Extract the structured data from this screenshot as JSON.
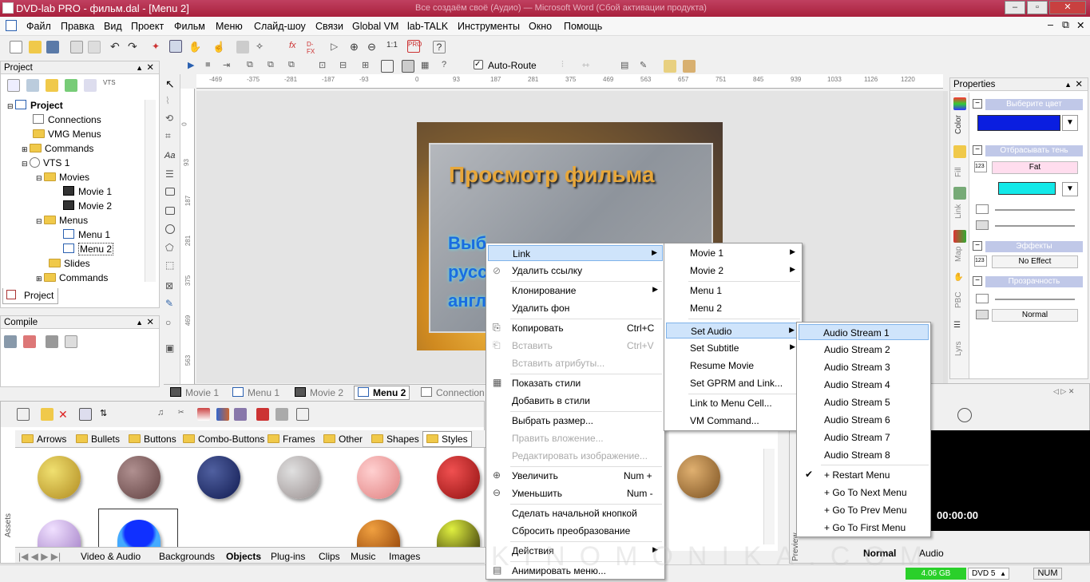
{
  "window": {
    "title": "DVD-lab PRO - фильм.dal - [Menu 2]",
    "center_title": "Все создаём своё (Аудио) — Microsoft Word (Сбой активации продукта)"
  },
  "menubar": [
    "Файл",
    "Правка",
    "Вид",
    "Проект",
    "Фильм",
    "Меню",
    "Слайд-шоу",
    "Связи",
    "Global VM",
    "lab-TALK",
    "Инструменты",
    "Окно",
    "Помощь"
  ],
  "toolbar2": {
    "autoroute": "Auto-Route"
  },
  "project_panel": {
    "title": "Project",
    "tab": "Project",
    "tree": [
      {
        "label": "Project",
        "bold": true
      },
      {
        "label": "Connections"
      },
      {
        "label": "VMG Menus"
      },
      {
        "label": "Commands"
      },
      {
        "label": "VTS 1"
      },
      {
        "label": "Movies"
      },
      {
        "label": "Movie 1"
      },
      {
        "label": "Movie 2"
      },
      {
        "label": "Menus"
      },
      {
        "label": "Menu 1"
      },
      {
        "label": "Menu 2"
      },
      {
        "label": "Slides"
      },
      {
        "label": "Commands"
      }
    ]
  },
  "compile_panel": {
    "title": "Compile"
  },
  "ruler": {
    "h": [
      "-469",
      "-375",
      "-281",
      "-187",
      "-93",
      "0",
      "93",
      "187",
      "281",
      "375",
      "469",
      "563",
      "657",
      "751",
      "845",
      "939",
      "1033",
      "1126",
      "1220"
    ],
    "v": [
      "0",
      "93",
      "187",
      "281",
      "375",
      "469",
      "563"
    ]
  },
  "menu_canvas": {
    "title": "Просмотр фильма",
    "line1": "Выбор звуковой дорожки",
    "line2": "русс",
    "line3": "англ"
  },
  "doc_tabs": [
    "Movie 1",
    "Menu 1",
    "Movie 2",
    "Menu 2",
    "Connection"
  ],
  "properties": {
    "title": "Properties",
    "sections": [
      "Выберите цвет",
      "Отбрасывать тень",
      "Эффекты",
      "Прозрачность"
    ],
    "shadow_value": "Fat",
    "effect_value": "No Effect",
    "blend_value": "Normal",
    "side_tabs": [
      "Color",
      "Fill",
      "Link",
      "Map",
      "PBC",
      "Lyrs"
    ],
    "num_label": "123"
  },
  "context_menu": {
    "items": [
      {
        "label": "Link",
        "shortcut": "",
        "arrow": true,
        "highlight": true
      },
      {
        "label": "Удалить ссылку"
      },
      {
        "label": "Клонирование",
        "arrow": true
      },
      {
        "label": "Удалить фон"
      },
      {
        "label": "Копировать",
        "shortcut": "Ctrl+C"
      },
      {
        "label": "Вставить",
        "shortcut": "Ctrl+V",
        "disabled": true
      },
      {
        "label": "Вставить атрибуты...",
        "disabled": true
      },
      {
        "label": "Показать стили"
      },
      {
        "label": "Добавить в стили"
      },
      {
        "label": "Выбрать размер..."
      },
      {
        "label": "Править вложение...",
        "disabled": true
      },
      {
        "label": "Редактировать изображение...",
        "disabled": true
      },
      {
        "label": "Увеличить",
        "shortcut": "Num +"
      },
      {
        "label": "Уменьшить",
        "shortcut": "Num -"
      },
      {
        "label": "Сделать начальной кнопкой"
      },
      {
        "label": "Сбросить преобразование"
      },
      {
        "label": "Действия",
        "arrow": true
      },
      {
        "label": "Анимировать меню..."
      }
    ]
  },
  "link_menu": {
    "items": [
      {
        "label": "Movie 1",
        "arrow": true
      },
      {
        "label": "Movie 2",
        "arrow": true
      },
      {
        "label": "Menu 1"
      },
      {
        "label": "Menu 2"
      },
      {
        "label": "Set Audio",
        "arrow": true,
        "highlight": true
      },
      {
        "label": "Set Subtitle",
        "arrow": true
      },
      {
        "label": "Resume Movie"
      },
      {
        "label": "Set GPRM and Link..."
      },
      {
        "label": "Link to Menu Cell..."
      },
      {
        "label": "VM Command..."
      }
    ]
  },
  "audio_menu": {
    "items": [
      "Audio Stream 1",
      "Audio Stream 2",
      "Audio Stream 3",
      "Audio Stream 4",
      "Audio Stream 5",
      "Audio Stream 6",
      "Audio Stream 7",
      "Audio Stream 8"
    ],
    "actions": [
      "+ Restart Menu",
      "+ Go To Next Menu",
      "+ Go To Prev Menu",
      "+ Go To First Menu"
    ]
  },
  "assets": {
    "folder_tabs": [
      "Arrows",
      "Bullets",
      "Buttons",
      "Combo-Buttons",
      "Frames",
      "Other",
      "Shapes",
      "Styles"
    ],
    "bottom_tabs": [
      "Video & Audio",
      "Backgrounds",
      "Objects",
      "Plug-ins",
      "Clips",
      "Music",
      "Images"
    ],
    "side_label": "Assets"
  },
  "preview": {
    "time": "00:00:00",
    "tabs": [
      "Normal",
      "Audio"
    ],
    "side_label": "Preview"
  },
  "statusbar": {
    "space": "4.06 GB",
    "disc": "DVD 5",
    "num": "NUM"
  },
  "watermark": "KINOMONIKA.COM"
}
